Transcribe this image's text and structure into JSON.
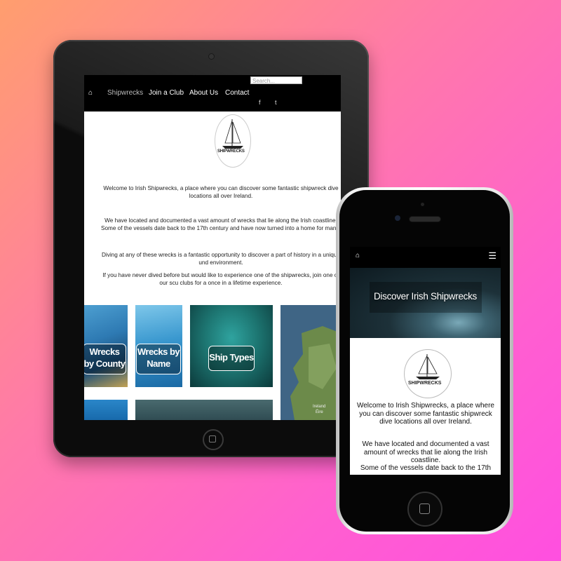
{
  "tablet": {
    "search_placeholder": "Search...",
    "nav": {
      "home_icon": "home-icon",
      "items": [
        "Shipwrecks",
        "Join a Club",
        "About Us",
        "Contact"
      ],
      "social": {
        "facebook": "f",
        "twitter": "t"
      }
    },
    "logo_text": "SHIPWRECKS",
    "paragraphs": [
      "Welcome to Irish Shipwrecks, a place where you can discover some fantastic shipwreck dive locations all over Ireland.",
      "We have located and documented a vast amount of wrecks that lie along the Irish coastline.",
      "Some of the vessels date back to the 17th century and have now turned into a home for many sea in",
      "Diving at any of these wrecks is a fantastic opportunity to discover a part of history in a unique und environment.",
      "If you have never dived before but would like to experience one of the shipwrecks, join one of our scu clubs for a once in a lifetime experience."
    ],
    "tiles": [
      "Wrecks by County",
      "Wrecks by Name",
      "Ship Types"
    ],
    "map_labels": {
      "ireland": "Ireland",
      "eire": "Éire"
    }
  },
  "phone": {
    "home_icon": "home-icon",
    "menu_icon": "hamburger-menu-icon",
    "hero_title": "Discover Irish Shipwrecks",
    "logo_text": "SHIPWRECKS",
    "paragraphs": [
      "Welcome to Irish Shipwrecks, a place where you can discover some fantastic shipwreck dive locations all over Ireland.",
      "We have located and documented a vast amount of wrecks that lie along the Irish coastline.",
      "Some of the vessels date back to the 17th"
    ]
  },
  "colors": {
    "nav_bg": "#000000",
    "bg_start": "#ff9e6e",
    "bg_end": "#ff4fe0"
  }
}
